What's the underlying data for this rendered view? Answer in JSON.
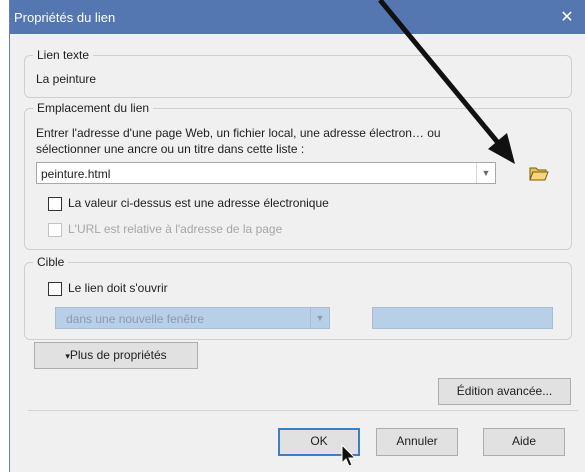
{
  "dialog": {
    "title": "Propriétés du lien",
    "close_glyph": "✕"
  },
  "link_text_group": {
    "legend": "Lien texte",
    "value": "La peinture"
  },
  "location_group": {
    "legend": "Emplacement du lien",
    "instruction_line1": "Entrer l'adresse d'une page Web, un fichier local, une adresse électron… ou",
    "instruction_line2": "sélectionner une ancre ou un titre dans cette liste :",
    "url_value": "peinture.html",
    "email_checkbox_label": "La valeur ci-dessus est une adresse électronique",
    "email_checked": false,
    "relative_checkbox_label": "L'URL est relative à l'adresse de la page",
    "relative_checked": false
  },
  "target_group": {
    "legend": "Cible",
    "open_checkbox_label": "Le lien doit s'ouvrir",
    "open_checked": false,
    "window_select_value": "dans une nouvelle fenêtre"
  },
  "buttons": {
    "more_properties": "Plus de propriétés",
    "more_properties_marker": "▾",
    "advanced_edit": "Édition avancée...",
    "ok": "OK",
    "cancel": "Annuler",
    "help": "Aide"
  },
  "colors": {
    "titlebar": "#5477b2",
    "annotation_arrow": "#111111",
    "disabled_field": "#b8cfe8"
  }
}
